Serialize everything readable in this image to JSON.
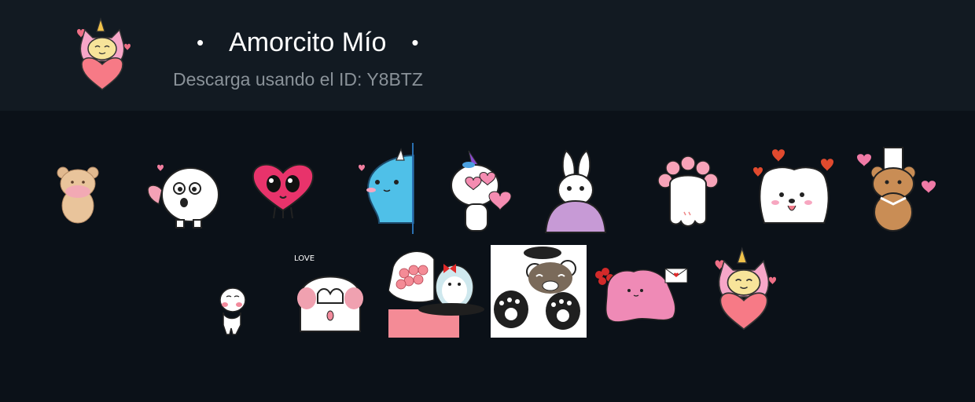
{
  "pack": {
    "bullet": "•",
    "title": "Amorcito Mío",
    "subtitle": "Descarga usando el ID: Y8BTZ"
  },
  "stickers": [
    {
      "icon": "teddy-bear-sticker-icon"
    },
    {
      "icon": "white-blob-heart-sticker-icon"
    },
    {
      "icon": "red-heart-character-sticker-icon"
    },
    {
      "icon": "blue-narwhal-peek-sticker-icon"
    },
    {
      "icon": "unicorn-hearts-sticker-icon"
    },
    {
      "icon": "bunny-girl-hoodie-sticker-icon"
    },
    {
      "icon": "flower-ghost-back-sticker-icon"
    },
    {
      "icon": "white-dog-hearts-sticker-icon"
    },
    {
      "icon": "bear-chef-hat-sticker-icon"
    },
    {
      "icon": "tiny-white-bean-sticker-icon"
    },
    {
      "icon": "white-blob-hiding-face-sticker-icon"
    },
    {
      "icon": "penguin-roses-bouquet-sticker-icon"
    },
    {
      "icon": "panda-bear-paws-sticker-icon"
    },
    {
      "icon": "pink-blob-roses-letter-sticker-icon"
    },
    {
      "icon": "unicorn-cat-heart-sticker-icon"
    }
  ]
}
